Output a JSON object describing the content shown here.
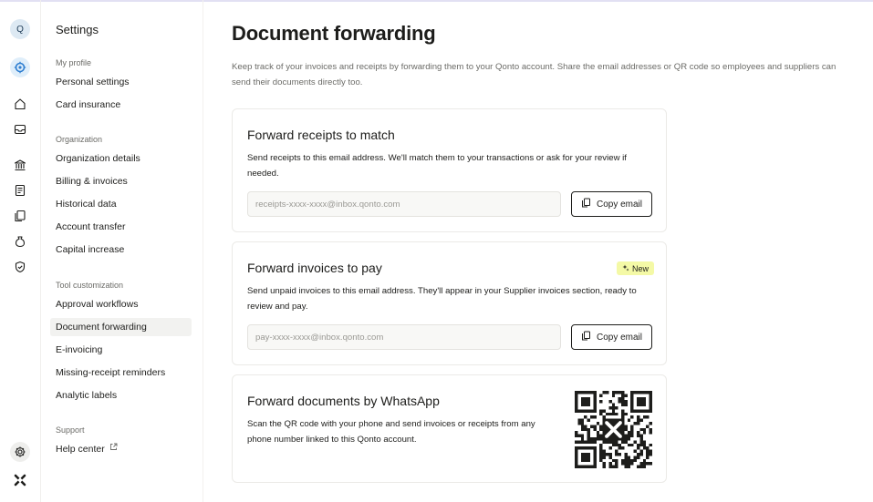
{
  "rail": {
    "avatar_initial": "Q",
    "icons": [
      "active-account-icon",
      "home-icon",
      "inbox-icon",
      "bank-icon",
      "invoice-icon",
      "documents-icon",
      "savings-icon",
      "shield-icon",
      "settings-icon",
      "qonto-logo-icon"
    ]
  },
  "nav": {
    "title": "Settings",
    "sections": {
      "profile": "My profile",
      "organization": "Organization",
      "tools": "Tool customization",
      "support": "Support"
    },
    "items": {
      "personal_settings": "Personal settings",
      "card_insurance": "Card insurance",
      "organization_details": "Organization details",
      "billing_invoices": "Billing & invoices",
      "historical_data": "Historical data",
      "account_transfer": "Account transfer",
      "capital_increase": "Capital increase",
      "approval_workflows": "Approval workflows",
      "document_forwarding": "Document forwarding",
      "e_invoicing": "E-invoicing",
      "missing_receipt_reminders": "Missing-receipt reminders",
      "analytic_labels": "Analytic labels",
      "help_center": "Help center"
    },
    "active": "Document forwarding"
  },
  "main": {
    "title": "Document forwarding",
    "description": "Keep track of your invoices and receipts by forwarding them to your Qonto account. Share the email addresses or QR code so employees and suppliers can send their documents directly too.",
    "receipts_card": {
      "title": "Forward receipts to match",
      "description": "Send receipts to this email address. We'll match them to your transactions or ask for your review if needed.",
      "email_placeholder": "receipts-xxxx-xxxx@inbox.qonto.com",
      "copy_label": "Copy email"
    },
    "invoices_card": {
      "title": "Forward invoices to pay",
      "badge": "New",
      "description": "Send unpaid invoices to this email address. They'll appear in your Supplier invoices section, ready to review and pay.",
      "email_placeholder": "pay-xxxx-xxxx@inbox.qonto.com",
      "copy_label": "Copy email"
    },
    "whatsapp_card": {
      "title": "Forward documents by WhatsApp",
      "description": "Scan the QR code with your phone and send invoices or receipts from any phone number linked to this Qonto account."
    }
  },
  "colors": {
    "text": "#1d1d1b",
    "muted": "#6b6b67",
    "badge_bg": "#f4f9a6",
    "avatar_bg": "#dde9f3",
    "active_nav_bg": "#f2f2f0"
  }
}
